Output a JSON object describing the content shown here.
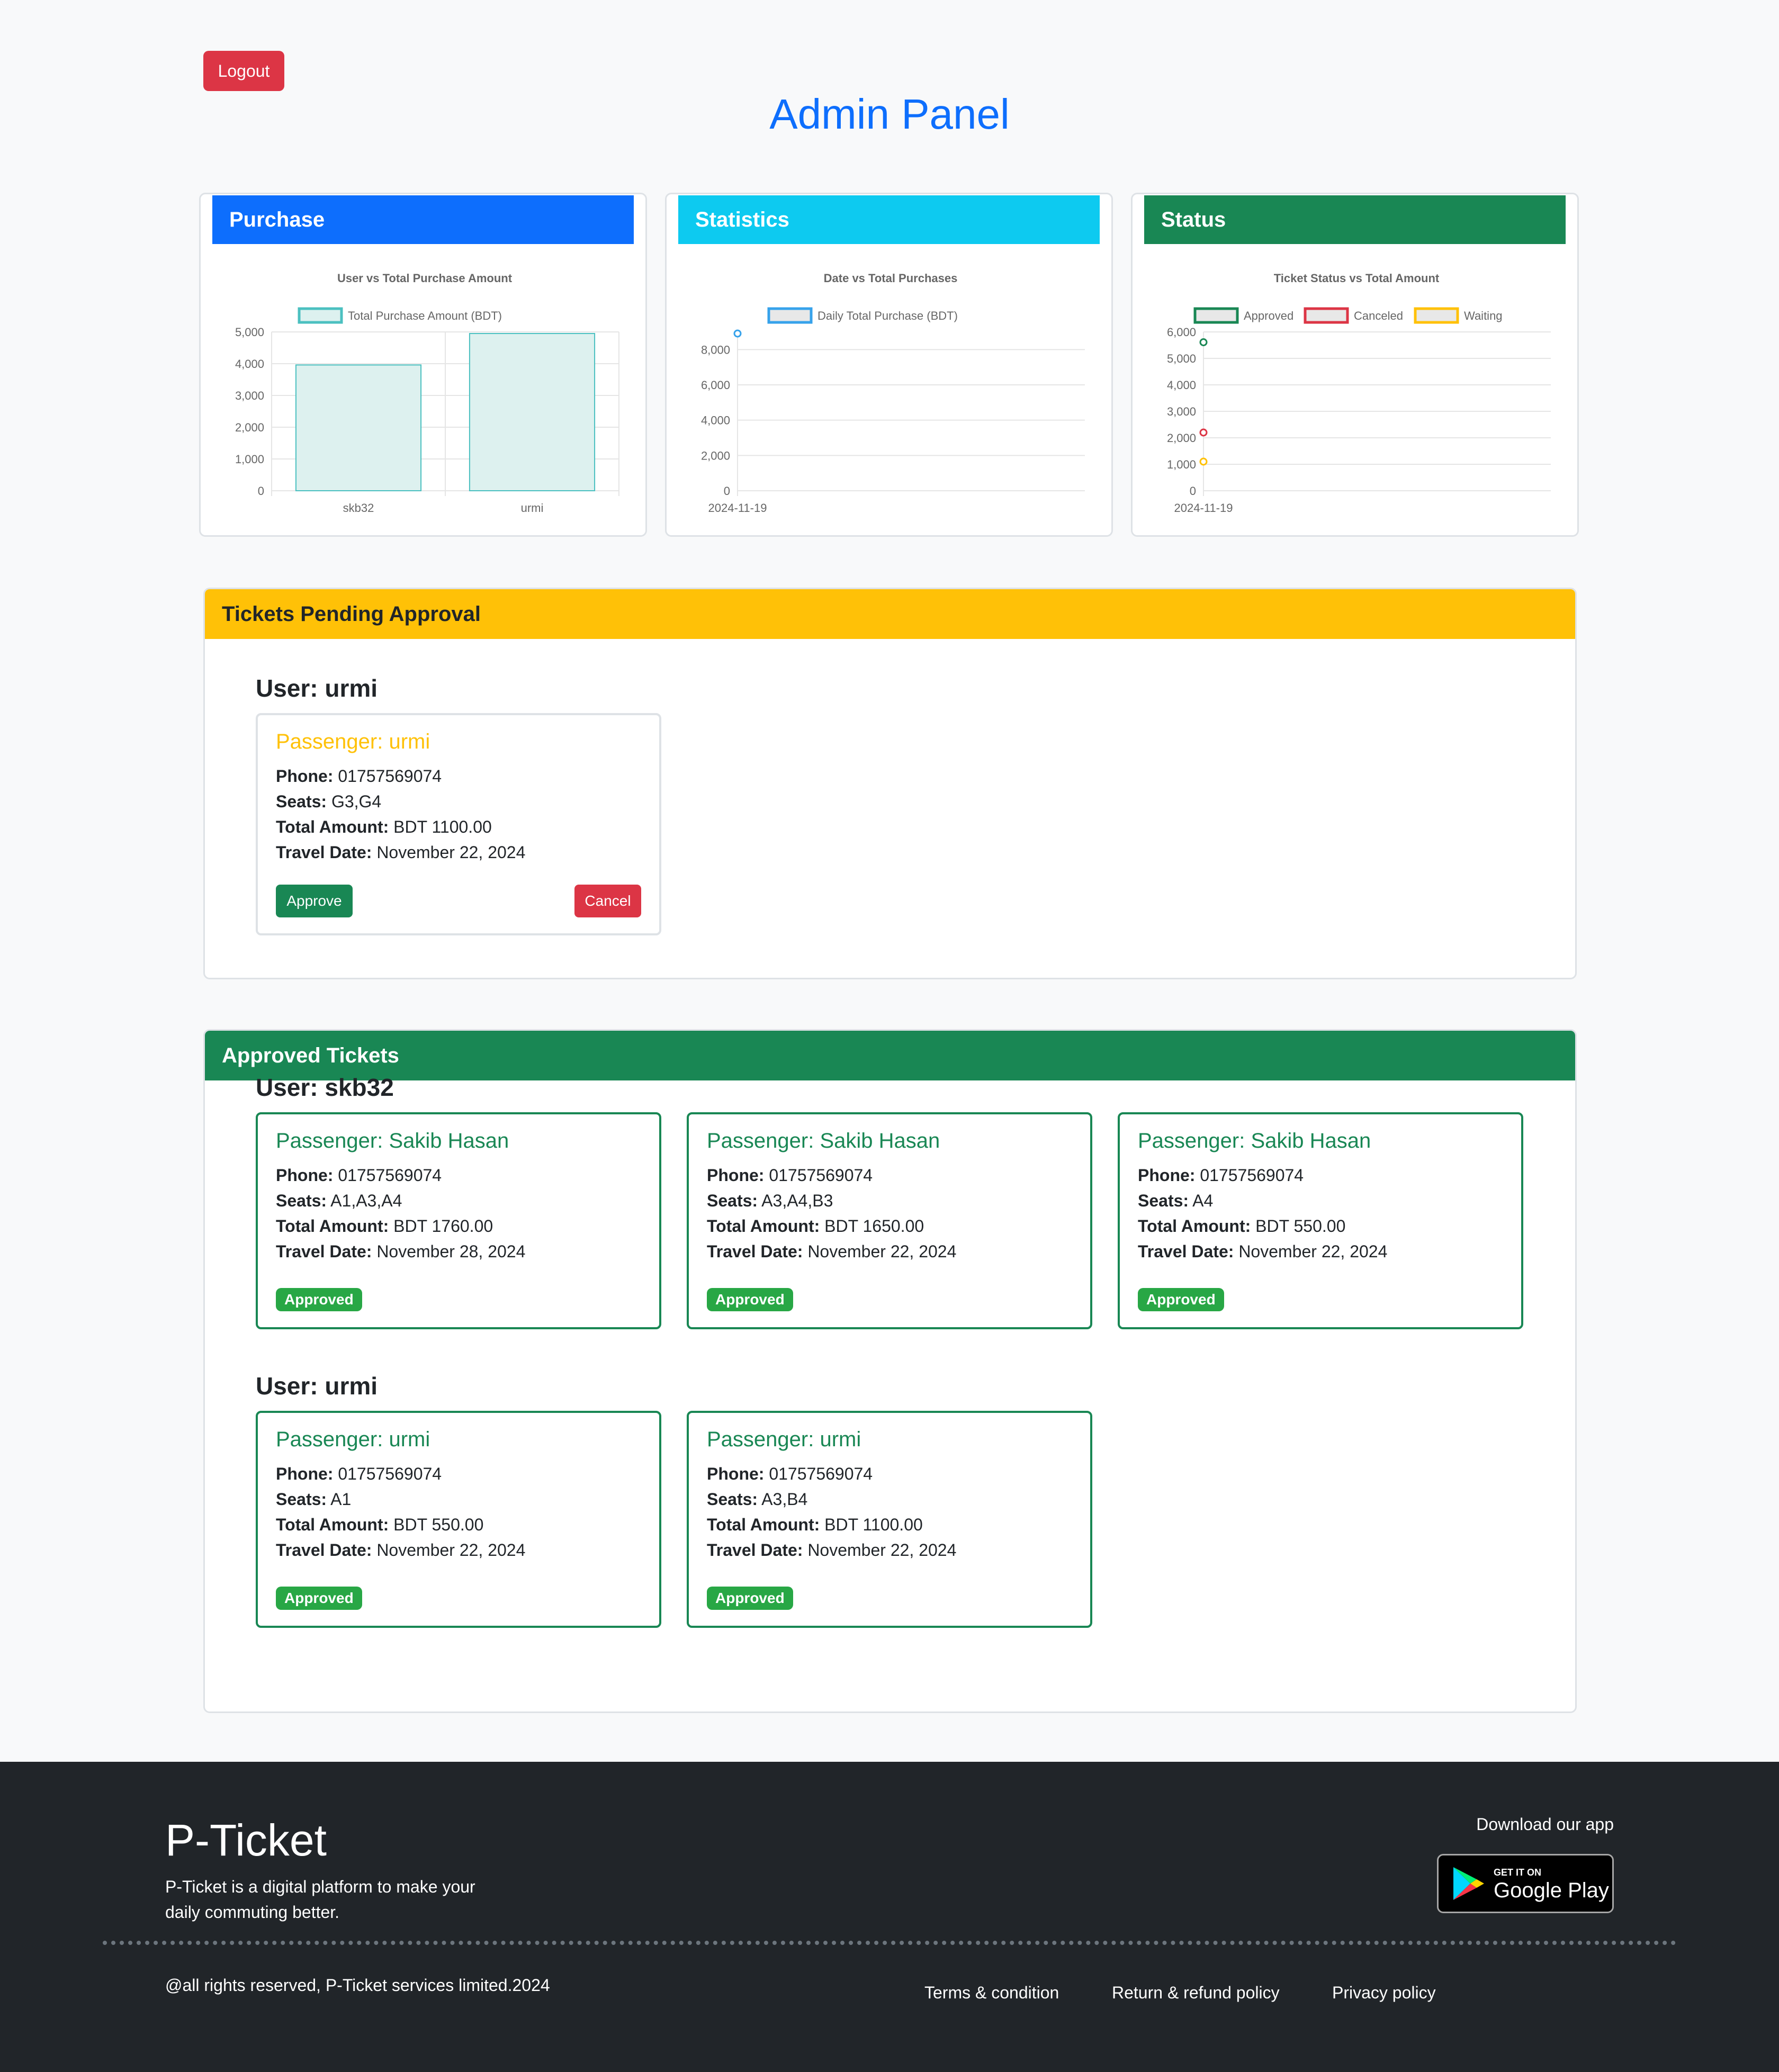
{
  "header": {
    "logout_label": "Logout",
    "title": "Admin Panel"
  },
  "cards": {
    "purchase": {
      "title": "Purchase",
      "color": "#0d6efd"
    },
    "statistics": {
      "title": "Statistics",
      "color": "#0dcaf0"
    },
    "status": {
      "title": "Status",
      "color": "#198754"
    }
  },
  "chart_data": [
    {
      "type": "bar",
      "title": "User vs Total Purchase Amount",
      "categories": [
        "skb32",
        "urmi"
      ],
      "series": [
        {
          "name": "Total Purchase Amount (BDT)",
          "values": [
            3960,
            4950
          ]
        }
      ],
      "ylim": [
        0,
        5000
      ],
      "yticks": [
        "0",
        "1,000",
        "2,000",
        "3,000",
        "4,000",
        "5,000"
      ],
      "grid": true,
      "legend": "top",
      "colors": {
        "fill": "#ddf1ef",
        "stroke": "#4bc0c0"
      }
    },
    {
      "type": "line",
      "title": "Date vs Total Purchases",
      "x": [
        "2024-11-19"
      ],
      "series": [
        {
          "name": "Daily Total Purchase (BDT)",
          "values": [
            8910
          ]
        }
      ],
      "ylim": [
        0,
        9000
      ],
      "yticks": [
        "0",
        "2,000",
        "4,000",
        "6,000",
        "8,000"
      ],
      "ytick_values": [
        0,
        2000,
        4000,
        6000,
        8000
      ],
      "grid": true,
      "legend": "top",
      "colors": {
        "line": "#36a2eb"
      }
    },
    {
      "type": "line",
      "title": "Ticket Status vs Total Amount",
      "x": [
        "2024-11-19"
      ],
      "series": [
        {
          "name": "Approved",
          "values": [
            5610
          ],
          "color": "#198754"
        },
        {
          "name": "Canceled",
          "values": [
            2200
          ],
          "color": "#dc3545"
        },
        {
          "name": "Waiting",
          "values": [
            1100
          ],
          "color": "#ffc107"
        }
      ],
      "ylim": [
        0,
        6000
      ],
      "yticks": [
        "0",
        "1,000",
        "2,000",
        "3,000",
        "4,000",
        "5,000",
        "6,000"
      ],
      "grid": true,
      "legend": "top"
    }
  ],
  "pending": {
    "header": "Tickets Pending Approval",
    "header_color": "#ffc107",
    "user_heading": "User: urmi",
    "ticket": {
      "passenger": "Passenger: urmi",
      "phone_label": "Phone:",
      "phone": " 01757569074",
      "seats_label": "Seats:",
      "seats": " G3,G4",
      "amount_label": "Total Amount:",
      "amount": " BDT 1100.00",
      "date_label": "Travel Date:",
      "date": " November 22, 2024",
      "approve_label": "Approve",
      "cancel_label": "Cancel"
    }
  },
  "approved": {
    "header": "Approved Tickets",
    "header_color": "#198754",
    "badge_label": "Approved",
    "groups": [
      {
        "user_heading": "User: skb32",
        "tickets": [
          {
            "passenger": "Passenger: Sakib Hasan",
            "phone": " 01757569074",
            "seats": " A1,A3,A4",
            "amount": " BDT 1760.00",
            "date": " November 28, 2024"
          },
          {
            "passenger": "Passenger: Sakib Hasan",
            "phone": " 01757569074",
            "seats": " A3,A4,B3",
            "amount": " BDT 1650.00",
            "date": " November 22, 2024"
          },
          {
            "passenger": "Passenger: Sakib Hasan",
            "phone": " 01757569074",
            "seats": " A4",
            "amount": " BDT 550.00",
            "date": " November 22, 2024"
          }
        ]
      },
      {
        "user_heading": "User: urmi",
        "tickets": [
          {
            "passenger": "Passenger: urmi",
            "phone": " 01757569074",
            "seats": " A1",
            "amount": " BDT 550.00",
            "date": " November 22, 2024"
          },
          {
            "passenger": "Passenger: urmi",
            "phone": " 01757569074",
            "seats": " A3,B4",
            "amount": " BDT 1100.00",
            "date": " November 22, 2024"
          }
        ]
      }
    ],
    "labels": {
      "phone": "Phone:",
      "seats": "Seats:",
      "amount": "Total Amount:",
      "date": "Travel Date:"
    }
  },
  "footer": {
    "brand": "P-Ticket",
    "tagline": "P-Ticket is a digital platform to make your daily commuting better.",
    "download_label": "Download our app",
    "gplay_small": "GET IT ON",
    "gplay_big": "Google Play",
    "copyright": "@all rights reserved, P-Ticket services limited.2024",
    "links": [
      "Terms & condition",
      "Return & refund policy",
      "Privacy policy"
    ]
  }
}
